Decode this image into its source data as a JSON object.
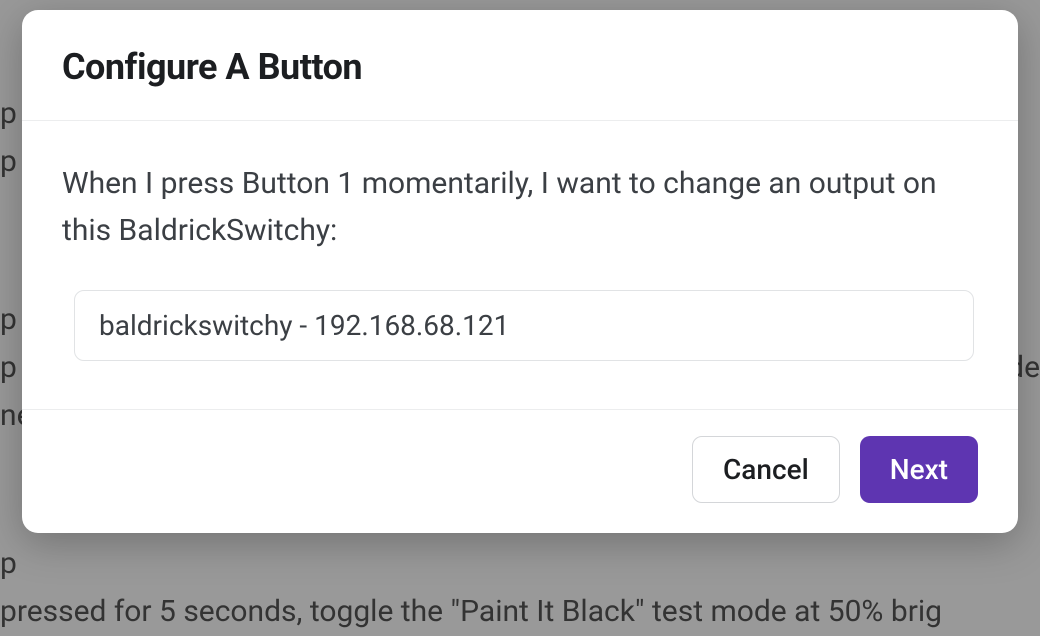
{
  "modal": {
    "title": "Configure A Button",
    "prompt": "When I press Button 1 momentarily, I want to change an output on this BaldrickSwitchy:",
    "select_value": "baldrickswitchy - 192.168.68.121",
    "cancel_label": "Cancel",
    "next_label": "Next"
  },
  "background": {
    "line1": "p",
    "line2": "p",
    "line3": "p",
    "line4": "p",
    "line4_right": "de",
    "line5": "ne",
    "line6": "p",
    "line7": "pressed for 5 seconds, toggle the \"Paint It Black\" test mode at 50% brig"
  }
}
